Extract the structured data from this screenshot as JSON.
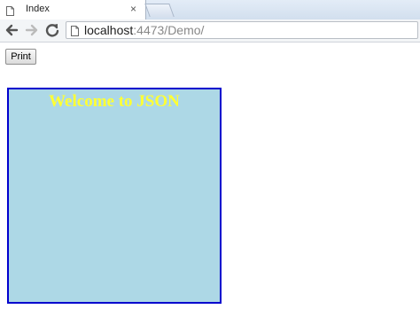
{
  "browser": {
    "tab_title": "Index",
    "close_glyph": "×",
    "url_host": "localhost",
    "url_path": ":4473/Demo/"
  },
  "page": {
    "print_label": "Print",
    "heading": "Welcome to JSON"
  },
  "colors": {
    "box_fill": "#add8e6",
    "box_border": "#0000cd",
    "heading_text": "#ffff33"
  },
  "icons": {
    "tab": "page-icon",
    "back": "back-arrow-icon",
    "forward": "forward-arrow-icon",
    "reload": "reload-icon",
    "omnibox": "document-icon",
    "close": "close-icon"
  }
}
